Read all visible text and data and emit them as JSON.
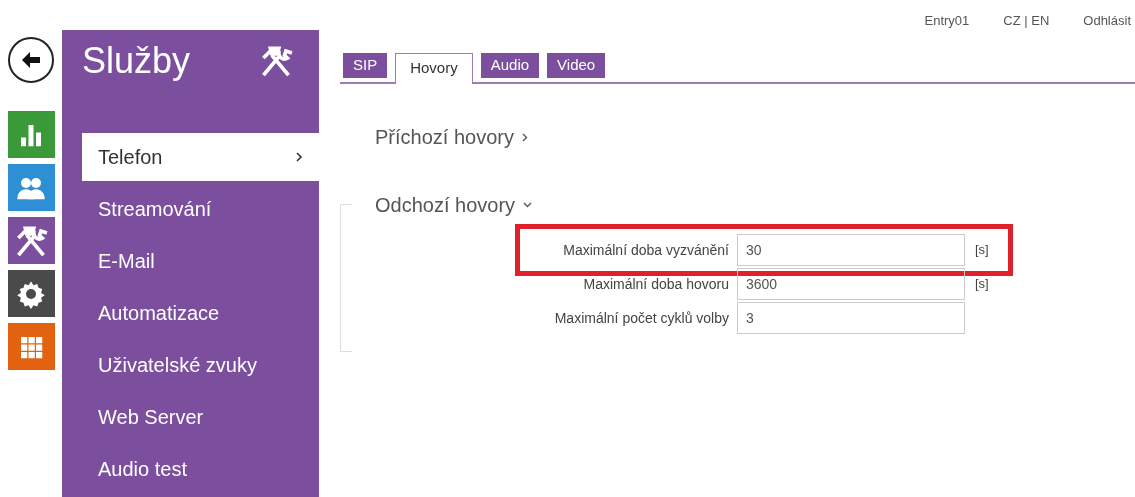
{
  "header_links": [
    "Entry01",
    "CZ | EN",
    "Odhlásit"
  ],
  "app_icons": [
    {
      "kind": "stats",
      "color": "#3a9a3a"
    },
    {
      "kind": "users",
      "color": "#2e8fd4"
    },
    {
      "kind": "tools",
      "color": "#7b4f9e"
    },
    {
      "kind": "settings",
      "color": "#4a4a4a"
    },
    {
      "kind": "apps",
      "color": "#e2620f"
    }
  ],
  "sidebar": {
    "title": "Služby",
    "items": [
      {
        "label": "Telefon",
        "selected": true
      },
      {
        "label": "Streamování",
        "selected": false
      },
      {
        "label": "E-Mail",
        "selected": false
      },
      {
        "label": "Automatizace",
        "selected": false
      },
      {
        "label": "Uživatelské zvuky",
        "selected": false
      },
      {
        "label": "Web Server",
        "selected": false
      },
      {
        "label": "Audio test",
        "selected": false
      }
    ]
  },
  "tabs": [
    {
      "label": "SIP",
      "selected": false
    },
    {
      "label": "Hovory",
      "selected": true
    },
    {
      "label": "Audio",
      "selected": false
    },
    {
      "label": "Video",
      "selected": false
    }
  ],
  "sections": [
    {
      "title": "Příchozí hovory",
      "expanded": false
    },
    {
      "title": "Odchozí hovory",
      "expanded": true,
      "fields": [
        {
          "label": "Maximální doba vyzvánění",
          "value": "30",
          "unit": "[s]",
          "highlighted": true
        },
        {
          "label": "Maximální doba hovoru",
          "value": "3600",
          "unit": "[s]",
          "highlighted": false
        },
        {
          "label": "Maximální počet cyklů volby",
          "value": "3",
          "highlighted": false
        }
      ]
    }
  ]
}
